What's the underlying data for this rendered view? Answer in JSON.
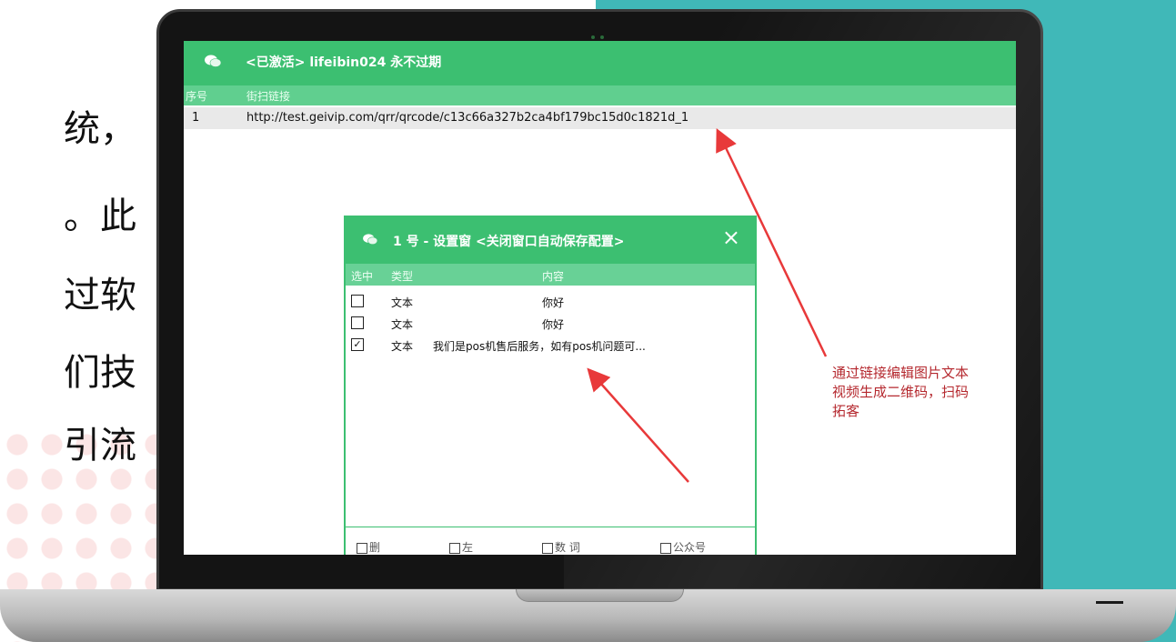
{
  "slide": {
    "left_text_lines": [
      "统，",
      "。此",
      "过软",
      "们技",
      "引流"
    ]
  },
  "app": {
    "title": "<已激活> lifeibin024 永不过期",
    "table_headers": [
      "序号",
      "街扫链接"
    ],
    "rows": [
      {
        "index": "1",
        "link": "http://test.geivip.com/qrr/qrcode/c13c66a327b2ca4bf179bc15d0c1821d_1"
      }
    ]
  },
  "dialog": {
    "title": "1 号 - 设置窗 <关闭窗口自动保存配置>",
    "close_label": "×",
    "headers": [
      "选中",
      "类型",
      "内容"
    ],
    "rows": [
      {
        "checked": false,
        "check_mark": "",
        "type": "文本",
        "content": "你好"
      },
      {
        "checked": false,
        "check_mark": "",
        "type": "文本",
        "content": "你好"
      },
      {
        "checked": true,
        "check_mark": "✓",
        "type": "文本",
        "content": "我们是pos机售后服务，如有pos机问题可..."
      }
    ],
    "footer": [
      "删",
      "左",
      "数 词",
      "公众号"
    ]
  },
  "annotation": {
    "lines": [
      "通过链接编辑图片文本",
      "视频生成二维码，扫码",
      "拓客"
    ]
  },
  "colors": {
    "accent_green": "#3cbf71",
    "header_green": "#60cf8f",
    "teal_panel": "#40b8b8",
    "annotation_red": "#b5292f"
  }
}
